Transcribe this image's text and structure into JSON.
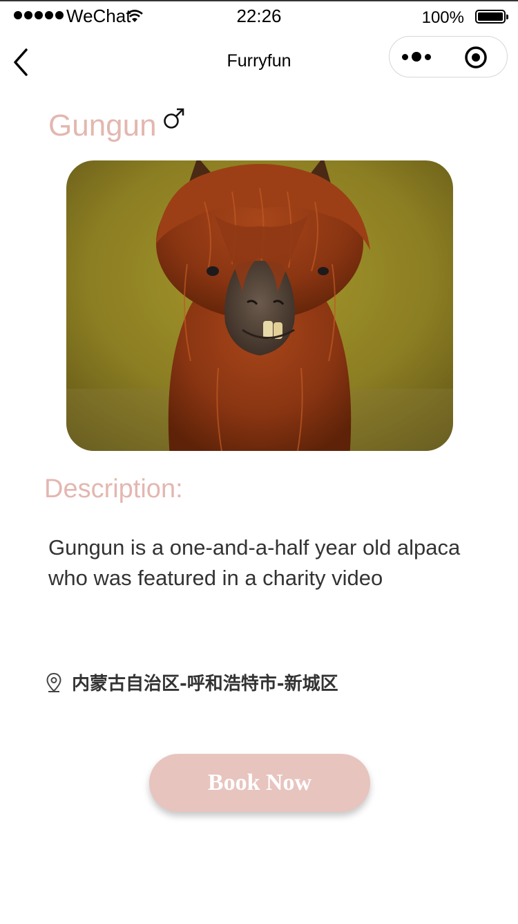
{
  "status_bar": {
    "carrier": "WeChat",
    "time": "22:26",
    "battery": "100%"
  },
  "nav": {
    "title": "Furryfun"
  },
  "pet": {
    "name": "Gungun",
    "gender_icon": "male-symbol-icon",
    "description_heading": "Description:",
    "description": "Gungun is a one-and-a-half year old alpaca who was featured in a charity video",
    "location": "内蒙古自治区-呼和浩特市-新城区",
    "book_label": "Book Now"
  },
  "colors": {
    "accent_pink": "#e3b7b0",
    "button_pink": "#e8c4bf",
    "text_dark": "#333333"
  }
}
